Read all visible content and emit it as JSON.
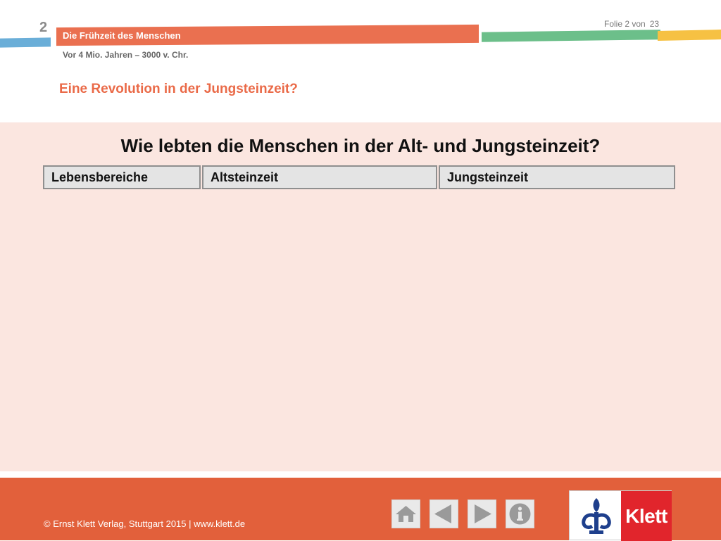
{
  "header": {
    "chapter_number": "2",
    "chapter_title": "Die Frühzeit des Menschen",
    "period": "Vor 4 Mio. Jahren – 3000 v. Chr.",
    "slide_label": "Folie 2 von",
    "slide_total": "23",
    "section_title": "Eine Revolution in der Jungsteinzeit?"
  },
  "main": {
    "question": "Wie lebten die Menschen in der Alt- und Jungsteinzeit?",
    "table_headers": [
      "Lebensbereiche",
      "Altsteinzeit",
      "Jungsteinzeit"
    ]
  },
  "footer": {
    "copyright": "© Ernst Klett Verlag, Stuttgart 2015 | www.klett.de",
    "nav_buttons": [
      "home-icon",
      "arrow-left-icon",
      "arrow-right-icon",
      "info-icon"
    ],
    "logo_text": "Klett"
  },
  "colors": {
    "accent_orange": "#ea7050",
    "footer_orange": "#e2603b",
    "content_bg": "#fbe6e0",
    "logo_red": "#e1252c",
    "stripe_blue": "#6aaed8",
    "stripe_green": "#6cbf8a",
    "stripe_yellow": "#f6c143"
  }
}
